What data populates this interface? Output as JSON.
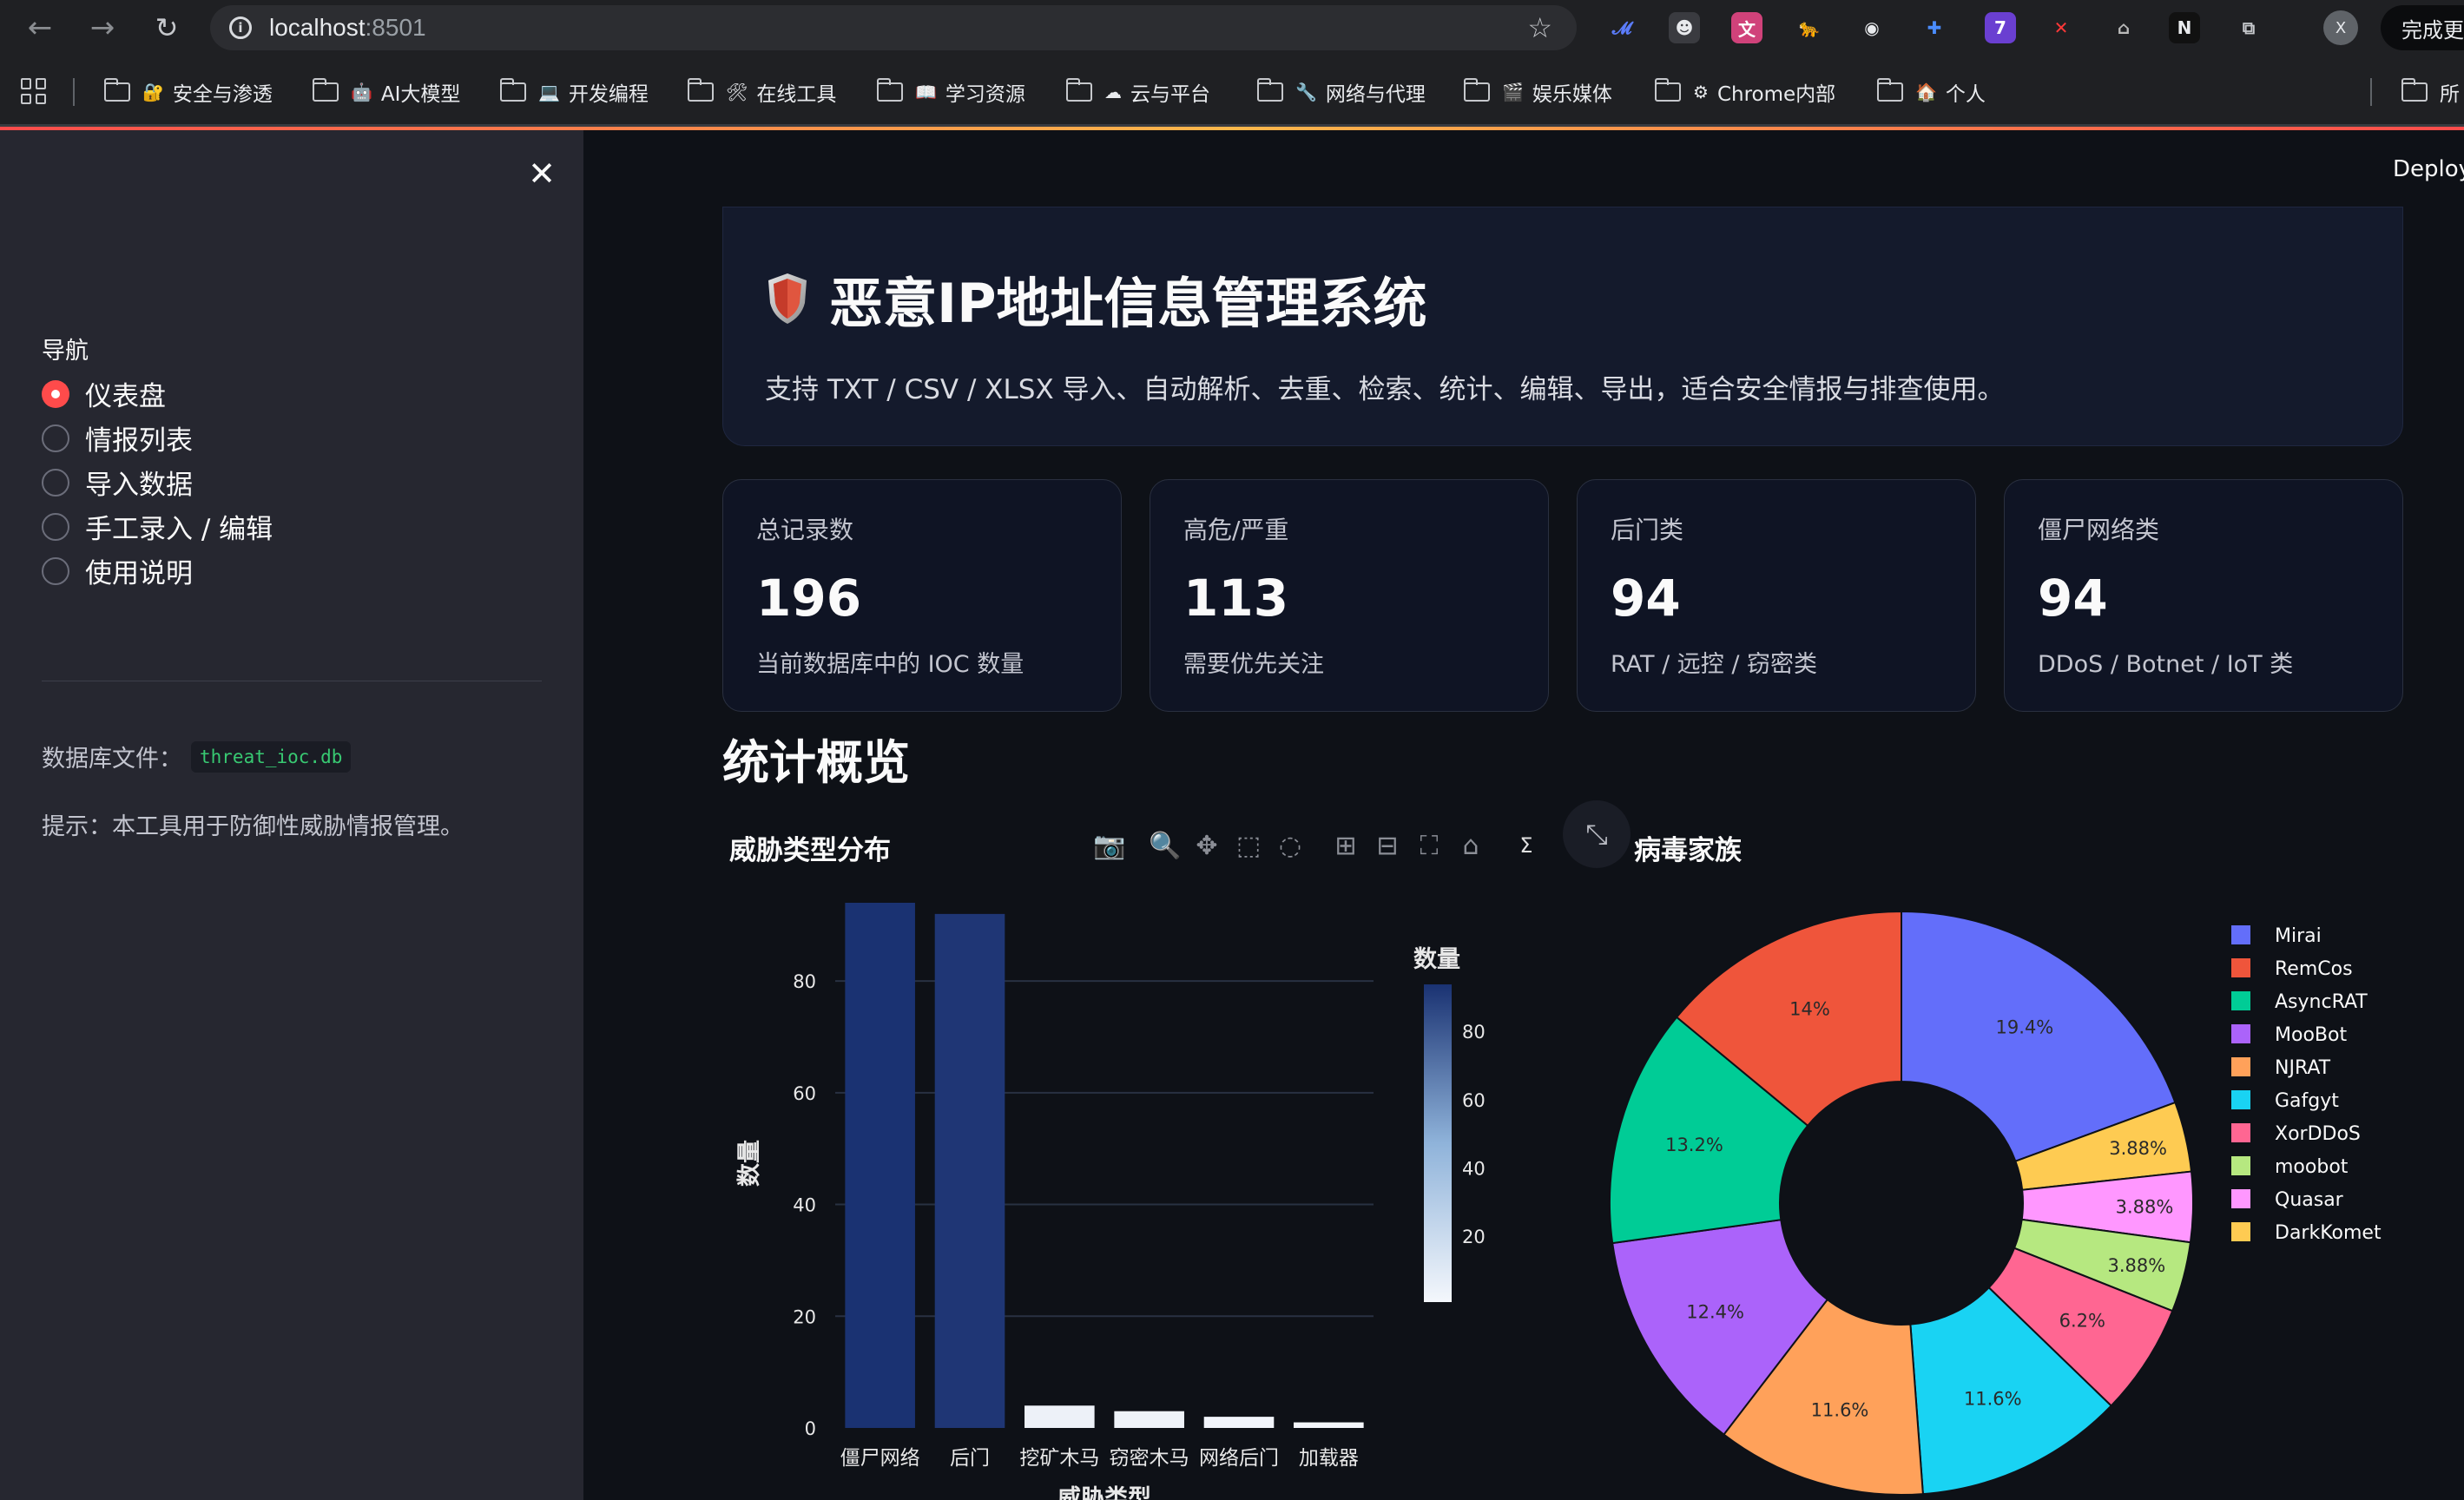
{
  "browser": {
    "url_host": "localhost",
    "url_port": ":8501",
    "profile_initial": "X",
    "update_label": "完成更",
    "extensions": [
      {
        "icon": "M-ext-icon",
        "glyph": "𝓜",
        "color": "#5b7cfa",
        "bg": "transparent"
      },
      {
        "icon": "ghost-ext-icon",
        "glyph": "☻",
        "color": "#e8eaed",
        "bg": "#3a3b40"
      },
      {
        "icon": "translate-ext-icon",
        "glyph": "文",
        "color": "#fff",
        "bg": "#d0427a"
      },
      {
        "icon": "cat-ext-icon",
        "glyph": "🐆",
        "color": "#f2b400",
        "bg": "transparent"
      },
      {
        "icon": "robot-ext-icon",
        "glyph": "◉",
        "color": "#e8eaed",
        "bg": "transparent"
      },
      {
        "icon": "puzzle-blue-ext-icon",
        "glyph": "✚",
        "color": "#4a8cff",
        "bg": "transparent"
      },
      {
        "icon": "badge-ext-icon",
        "glyph": "7",
        "color": "#fff",
        "bg": "#6a3fd1"
      },
      {
        "icon": "x-ext-icon",
        "glyph": "✕",
        "color": "#ff3838",
        "bg": "transparent"
      },
      {
        "icon": "hat-ext-icon",
        "glyph": "⌂",
        "color": "#bbb",
        "bg": "transparent"
      },
      {
        "icon": "n-ext-icon",
        "glyph": "N",
        "color": "#e8eaed",
        "bg": "#111"
      },
      {
        "icon": "extensions-puzzle-icon",
        "glyph": "⧉",
        "color": "#c6c8cc",
        "bg": "transparent"
      }
    ],
    "bookmarks": [
      {
        "label": "安全与渗透",
        "emoji": "🔐"
      },
      {
        "label": "AI大模型",
        "emoji": "🤖"
      },
      {
        "label": "开发编程",
        "emoji": "💻"
      },
      {
        "label": "在线工具",
        "emoji": "🛠"
      },
      {
        "label": "学习资源",
        "emoji": "📖"
      },
      {
        "label": "云与平台",
        "emoji": "☁"
      },
      {
        "label": "网络与代理",
        "emoji": "🔧"
      },
      {
        "label": "娱乐媒体",
        "emoji": "🎬"
      },
      {
        "label": "Chrome内部",
        "emoji": "⚙"
      },
      {
        "label": "个人",
        "emoji": "🏠"
      }
    ],
    "bookmarks_overflow": "所"
  },
  "sidebar": {
    "nav_title": "导航",
    "items": [
      {
        "label": "仪表盘",
        "selected": true
      },
      {
        "label": "情报列表",
        "selected": false
      },
      {
        "label": "导入数据",
        "selected": false
      },
      {
        "label": "手工录入 / 编辑",
        "selected": false
      },
      {
        "label": "使用说明",
        "selected": false
      }
    ],
    "db_label": "数据库文件：",
    "db_file": "threat_ioc.db",
    "tip": "提示：本工具用于防御性威胁情报管理。"
  },
  "main": {
    "deploy_label": "Deploy",
    "title": "恶意IP地址信息管理系统",
    "subtitle": "支持 TXT / CSV / XLSX 导入、自动解析、去重、检索、统计、编辑、导出，适合安全情报与排查使用。",
    "cards": [
      {
        "label": "总记录数",
        "value": "196",
        "sub": "当前数据库中的 IOC 数量"
      },
      {
        "label": "高危/严重",
        "value": "113",
        "sub": "需要优先关注"
      },
      {
        "label": "后门类",
        "value": "94",
        "sub": "RAT / 远控 / 窃密类"
      },
      {
        "label": "僵尸网络类",
        "value": "94",
        "sub": "DDoS / Botnet / IoT 类"
      }
    ],
    "section_title": "统计概览",
    "chart1_title": "威胁类型分布",
    "chart2_title": "病毒家族"
  },
  "chart_data": [
    {
      "type": "bar",
      "title": "威胁类型分布",
      "categories": [
        "僵尸网络",
        "后门",
        "挖矿木马",
        "窃密木马",
        "网络后门",
        "加载器"
      ],
      "values": [
        94,
        92,
        4,
        3,
        2,
        1
      ],
      "xlabel": "威胁类型",
      "ylabel": "数量",
      "ylim": [
        0,
        94
      ],
      "yticks": [
        0,
        20,
        40,
        60,
        80
      ],
      "colorbar": {
        "title": "数量",
        "ticks": [
          20,
          40,
          60,
          80
        ],
        "low": "#f4f7fc",
        "high": "#1a3272"
      },
      "grid": true
    },
    {
      "type": "pie",
      "title": "病毒家族",
      "hole": true,
      "legend": "right",
      "slices": [
        {
          "name": "Mirai",
          "pct": 19.4,
          "label": "19.4%",
          "color": "#636efa"
        },
        {
          "name": "DarkKomet",
          "pct": 3.88,
          "label": "3.88%",
          "color": "#fecb52"
        },
        {
          "name": "Quasar",
          "pct": 3.88,
          "label": "3.88%",
          "color": "#ff97ff"
        },
        {
          "name": "moobot",
          "pct": 3.88,
          "label": "3.88%",
          "color": "#b6e880"
        },
        {
          "name": "XorDDoS",
          "pct": 6.2,
          "label": "6.2%",
          "color": "#ff6692"
        },
        {
          "name": "Gafgyt",
          "pct": 11.6,
          "label": "11.6%",
          "color": "#19d3f3"
        },
        {
          "name": "NJRAT",
          "pct": 11.6,
          "label": "11.6%",
          "color": "#ffa15a"
        },
        {
          "name": "MooBot",
          "pct": 12.4,
          "label": "12.4%",
          "color": "#ab63fa"
        },
        {
          "name": "AsyncRAT",
          "pct": 13.2,
          "label": "13.2%",
          "color": "#00cc96"
        },
        {
          "name": "RemCos",
          "pct": 14,
          "label": "14%",
          "color": "#ef553b"
        }
      ],
      "legend_order": [
        "Mirai",
        "RemCos",
        "AsyncRAT",
        "MooBot",
        "NJRAT",
        "Gafgyt",
        "XorDDoS",
        "moobot",
        "Quasar",
        "DarkKomet"
      ]
    }
  ]
}
